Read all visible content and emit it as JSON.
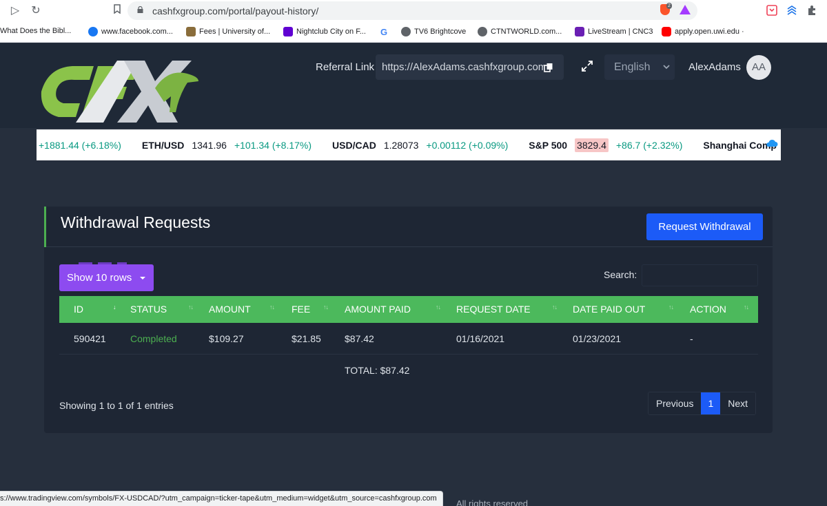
{
  "browser": {
    "url": "cashfxgroup.com/portal/payout-history/",
    "brave_count": "2",
    "bookmarks": [
      {
        "label": "What Does the Bibl...",
        "color": "#ffffff"
      },
      {
        "label": "www.facebook.com...",
        "color": "#1877f2"
      },
      {
        "label": "Fees | University of...",
        "color": "#8a6d3b"
      },
      {
        "label": "Nightclub City on F...",
        "color": "#6001d2"
      },
      {
        "label": "",
        "color": "#ffffff"
      },
      {
        "label": "TV6 Brightcove",
        "color": "#5f6368"
      },
      {
        "label": "CTNTWORLD.com...",
        "color": "#5f6368"
      },
      {
        "label": "LiveStream | CNC3",
        "color": "#6a1fb3"
      },
      {
        "label": "apply.open.uwi.edu ·",
        "color": "#ff0000"
      }
    ],
    "status_url": "s://www.tradingview.com/symbols/FX-USDCAD/?utm_campaign=ticker-tape&utm_medium=widget&utm_source=cashfxgroup.com"
  },
  "header": {
    "referral_label": "Referral Link",
    "referral_url": "https://AlexAdams.cashfxgroup.com",
    "language": "English",
    "username": "AlexAdams",
    "avatar_initials": "AA"
  },
  "ticker": [
    {
      "symbol": "",
      "price": "",
      "change": "+1881.44 (+6.18%)"
    },
    {
      "symbol": "ETH/USD",
      "price": "1341.96",
      "change": "+101.34 (+8.17%)"
    },
    {
      "symbol": "USD/CAD",
      "price": "1.28073",
      "change": "+0.00112 (+0.09%)"
    },
    {
      "symbol": "S&P 500",
      "price": "3829.4",
      "change": "+86.7 (+2.32%)",
      "highlight": true
    },
    {
      "symbol": "Shanghai Comp",
      "price": "",
      "change": ""
    }
  ],
  "card": {
    "title": "Withdrawal Requests",
    "request_button": "Request Withdrawal",
    "rows_button": "Show 10 rows",
    "search_label": "Search:",
    "search_value": "",
    "columns": [
      "ID",
      "STATUS",
      "AMOUNT",
      "FEE",
      "AMOUNT PAID",
      "REQUEST DATE",
      "DATE PAID OUT",
      "ACTION"
    ],
    "rows": [
      {
        "id": "590421",
        "status": "Completed",
        "amount": "$109.27",
        "fee": "$21.85",
        "amount_paid": "$87.42",
        "request_date": "01/16/2021",
        "date_paid_out": "01/23/2021",
        "action": "-"
      }
    ],
    "total": "TOTAL: $87.42",
    "info": "Showing 1 to 1 of 1 entries",
    "pagination": {
      "previous": "Previous",
      "current": "1",
      "next": "Next"
    }
  },
  "footer_peek": "All rights reserved",
  "colors": {
    "accent_green": "#4cb95c",
    "primary_blue": "#1c5bf7",
    "purple": "#8d4bf0",
    "ticker_up": "#089981"
  }
}
